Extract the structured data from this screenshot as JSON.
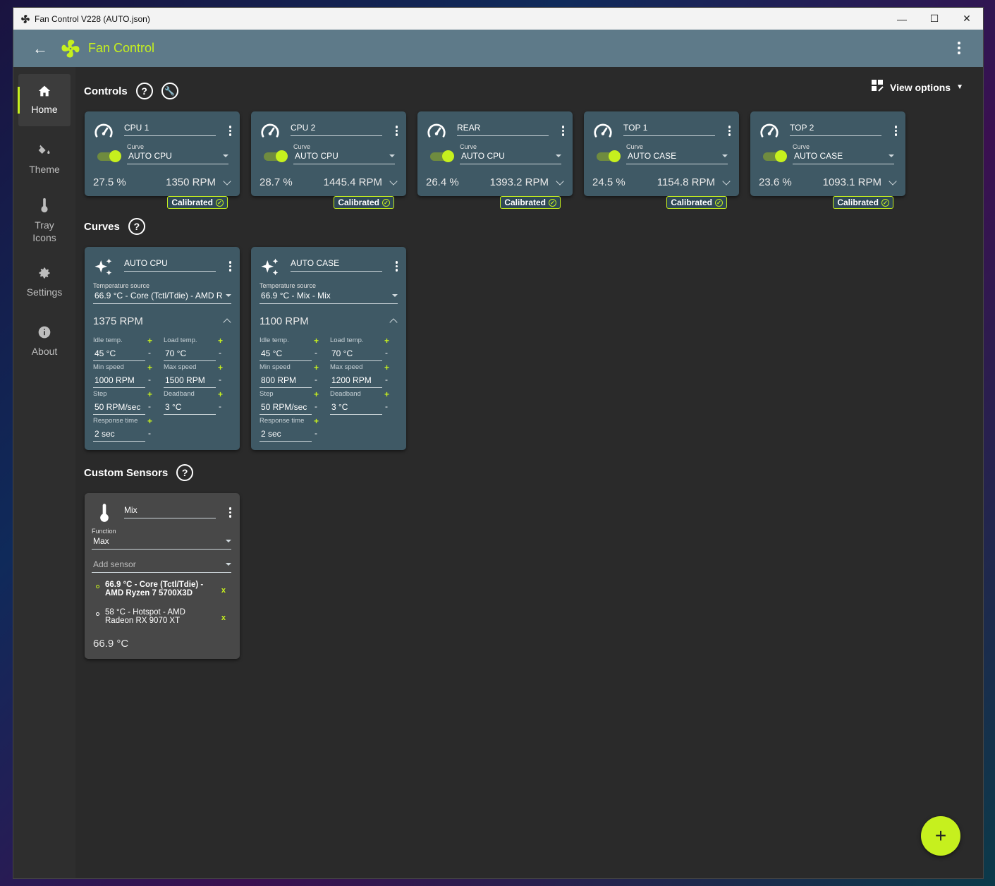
{
  "window": {
    "title": "Fan Control V228 (AUTO.json)"
  },
  "appbar": {
    "title": "Fan Control"
  },
  "sidebar": {
    "items": [
      {
        "label": "Home",
        "icon": "home-icon"
      },
      {
        "label": "Theme",
        "icon": "paint-bucket-icon"
      },
      {
        "label": "Tray Icons",
        "icon": "thermometer-icon"
      },
      {
        "label": "Settings",
        "icon": "gear-icon"
      },
      {
        "label": "About",
        "icon": "info-icon"
      }
    ]
  },
  "sections": {
    "controls": "Controls",
    "curves": "Curves",
    "custom_sensors": "Custom Sensors",
    "view_options": "View options"
  },
  "controls": [
    {
      "name": "CPU 1",
      "curve_label": "Curve",
      "curve": "AUTO CPU",
      "percent": "27.5 %",
      "rpm": "1350 RPM",
      "badge": "Calibrated"
    },
    {
      "name": "CPU 2",
      "curve_label": "Curve",
      "curve": "AUTO CPU",
      "percent": "28.7 %",
      "rpm": "1445.4 RPM",
      "badge": "Calibrated"
    },
    {
      "name": "REAR",
      "curve_label": "Curve",
      "curve": "AUTO CPU",
      "percent": "26.4 %",
      "rpm": "1393.2 RPM",
      "badge": "Calibrated"
    },
    {
      "name": "TOP 1",
      "curve_label": "Curve",
      "curve": "AUTO CASE",
      "percent": "24.5 %",
      "rpm": "1154.8 RPM",
      "badge": "Calibrated"
    },
    {
      "name": "TOP 2",
      "curve_label": "Curve",
      "curve": "AUTO CASE",
      "percent": "23.6 %",
      "rpm": "1093.1 RPM",
      "badge": "Calibrated"
    }
  ],
  "curves": [
    {
      "name": "AUTO CPU",
      "source_label": "Temperature source",
      "source": "66.9 °C - Core (Tctl/Tdie) - AMD R",
      "rpm": "1375 RPM",
      "idle_label": "Idle temp.",
      "idle": "45 °C",
      "load_label": "Load temp.",
      "load": "70 °C",
      "minspd_label": "Min speed",
      "minspd": "1000 RPM",
      "maxspd_label": "Max speed",
      "maxspd": "1500 RPM",
      "step_label": "Step",
      "step": "50 RPM/sec",
      "deadband_label": "Deadband",
      "deadband": "3 °C",
      "resp_label": "Response time",
      "resp": "2 sec"
    },
    {
      "name": "AUTO CASE",
      "source_label": "Temperature source",
      "source": "66.9 °C - Mix - Mix",
      "rpm": "1100 RPM",
      "idle_label": "Idle temp.",
      "idle": "45 °C",
      "load_label": "Load temp.",
      "load": "70 °C",
      "minspd_label": "Min speed",
      "minspd": "800 RPM",
      "maxspd_label": "Max speed",
      "maxspd": "1200 RPM",
      "step_label": "Step",
      "step": "50 RPM/sec",
      "deadband_label": "Deadband",
      "deadband": "3 °C",
      "resp_label": "Response time",
      "resp": "2 sec"
    }
  ],
  "sensor": {
    "name": "Mix",
    "function_label": "Function",
    "function": "Max",
    "add_placeholder": "Add sensor",
    "items": [
      {
        "line1": "66.9 °C - Core (Tctl/Tdie) -",
        "line2": "AMD Ryzen 7 5700X3D"
      },
      {
        "line1": "58 °C - Hotspot - AMD",
        "line2": "Radeon RX 9070 XT"
      }
    ],
    "remove": "x",
    "value": "66.9 °C"
  },
  "symbols": {
    "plus": "+",
    "minus": "-",
    "fab": "+"
  },
  "colors": {
    "accent": "#c6f01e",
    "card": "#3f5965",
    "appbar": "#5e7a89"
  }
}
